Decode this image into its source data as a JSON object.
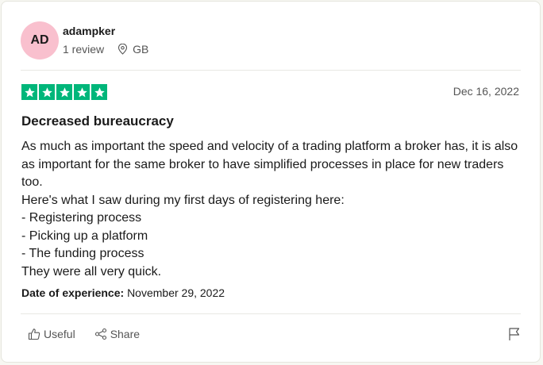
{
  "reviewer": {
    "initials": "AD",
    "name": "adampker",
    "review_count": "1 review",
    "country": "GB"
  },
  "review": {
    "rating": 5,
    "date": "Dec 16, 2022",
    "title": "Decreased bureaucracy",
    "body": "As much as important the speed and velocity of a trading platform a broker has, it is also as important for the same broker to have simplified processes in place for new traders too.\nHere's what I saw during my first days of registering here:\n- Registering process\n- Picking up a platform\n- The funding process\nThey were all very quick.",
    "experience_label": "Date of experience:",
    "experience_date": "November 29, 2022"
  },
  "actions": {
    "useful_label": "Useful",
    "share_label": "Share"
  },
  "colors": {
    "star_green": "#00b67a",
    "avatar_bg": "#f9c0ce"
  },
  "icons": [
    "location-pin-icon",
    "star-icon",
    "thumbs-up-icon",
    "share-icon",
    "flag-icon"
  ]
}
